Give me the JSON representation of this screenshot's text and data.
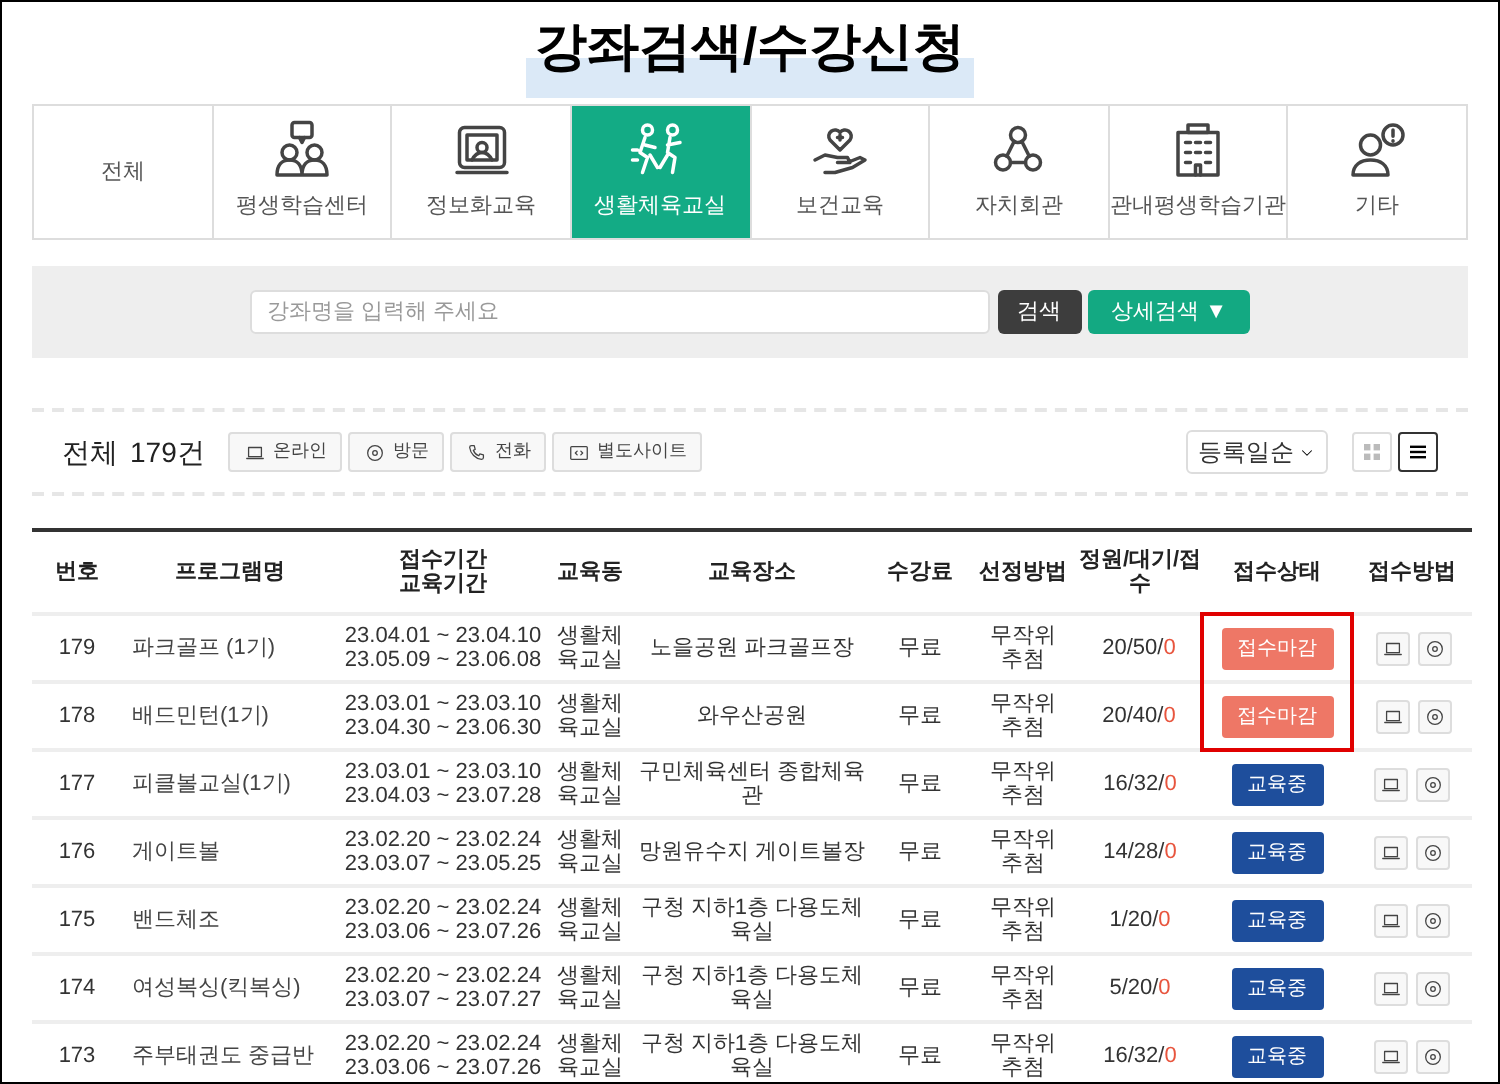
{
  "title": "강좌검색/수강신청",
  "categories": [
    {
      "label": "전체",
      "selected": false
    },
    {
      "label": "평생학습센터",
      "selected": false
    },
    {
      "label": "정보화교육",
      "selected": false
    },
    {
      "label": "생활체육교실",
      "selected": true
    },
    {
      "label": "보건교육",
      "selected": false
    },
    {
      "label": "자치회관",
      "selected": false
    },
    {
      "label": "관내평생학습기관",
      "selected": false
    },
    {
      "label": "기타",
      "selected": false
    }
  ],
  "search": {
    "placeholder": "강좌명을 입력해 주세요",
    "button": "검색",
    "detail_button": "상세검색 ▼"
  },
  "summary": {
    "label": "전체",
    "count": "179건"
  },
  "filters": [
    {
      "label": "온라인"
    },
    {
      "label": "방문"
    },
    {
      "label": "전화"
    },
    {
      "label": "별도사이트"
    }
  ],
  "sort": "등록일순",
  "views": [
    {
      "kind": "grid",
      "selected": false
    },
    {
      "kind": "list",
      "selected": true
    }
  ],
  "columns": [
    "번호",
    "프로그램명",
    "접수기간\n교육기간",
    "교육동",
    "교육장소",
    "수강료",
    "선정방법",
    "정원/대기/접수",
    "접수상태",
    "접수방법"
  ],
  "rows": [
    {
      "no": "179",
      "name": "파크골프 (1기)",
      "apply": "23.04.01 ~ 23.04.10",
      "edu": "23.05.09 ~ 23.06.08",
      "building": "생활체육교실",
      "place": "노을공원 파크골프장",
      "fee": "무료",
      "method": "무작위추첨",
      "quota": "20/50/",
      "applied": "0",
      "status": {
        "kind": "closed",
        "label": "접수마감"
      },
      "highlighted": true
    },
    {
      "no": "178",
      "name": "배드민턴(1기)",
      "apply": "23.03.01 ~ 23.03.10",
      "edu": "23.04.30 ~ 23.06.30",
      "building": "생활체육교실",
      "place": "와우산공원",
      "fee": "무료",
      "method": "무작위추첨",
      "quota": "20/40/",
      "applied": "0",
      "status": {
        "kind": "closed",
        "label": "접수마감"
      },
      "highlighted": true
    },
    {
      "no": "177",
      "name": "피클볼교실(1기)",
      "apply": "23.03.01 ~ 23.03.10",
      "edu": "23.04.03 ~ 23.07.28",
      "building": "생활체육교실",
      "place": "구민체육센터 종합체육관",
      "fee": "무료",
      "method": "무작위추첨",
      "quota": "16/32/",
      "applied": "0",
      "status": {
        "kind": "ongoing",
        "label": "교육중"
      },
      "highlighted": false
    },
    {
      "no": "176",
      "name": "게이트볼",
      "apply": "23.02.20 ~ 23.02.24",
      "edu": "23.03.07 ~ 23.05.25",
      "building": "생활체육교실",
      "place": "망원유수지 게이트볼장",
      "fee": "무료",
      "method": "무작위추첨",
      "quota": "14/28/",
      "applied": "0",
      "status": {
        "kind": "ongoing",
        "label": "교육중"
      },
      "highlighted": false
    },
    {
      "no": "175",
      "name": "밴드체조",
      "apply": "23.02.20 ~ 23.02.24",
      "edu": "23.03.06 ~ 23.07.26",
      "building": "생활체육교실",
      "place": "구청 지하1층 다용도체육실",
      "fee": "무료",
      "method": "무작위추첨",
      "quota": "1/20/",
      "applied": "0",
      "status": {
        "kind": "ongoing",
        "label": "교육중"
      },
      "highlighted": false
    },
    {
      "no": "174",
      "name": "여성복싱(킥복싱)",
      "apply": "23.02.20 ~ 23.02.24",
      "edu": "23.03.07 ~ 23.07.27",
      "building": "생활체육교실",
      "place": "구청 지하1층 다용도체육실",
      "fee": "무료",
      "method": "무작위추첨",
      "quota": "5/20/",
      "applied": "0",
      "status": {
        "kind": "ongoing",
        "label": "교육중"
      },
      "highlighted": false
    },
    {
      "no": "173",
      "name": "주부태권도 중급반",
      "apply": "23.02.20 ~ 23.02.24",
      "edu": "23.03.06 ~ 23.07.26",
      "building": "생활체육교실",
      "place": "구청 지하1층 다용도체육실",
      "fee": "무료",
      "method": "무작위추첨",
      "quota": "16/32/",
      "applied": "0",
      "status": {
        "kind": "ongoing",
        "label": "교육중"
      },
      "highlighted": false
    }
  ]
}
